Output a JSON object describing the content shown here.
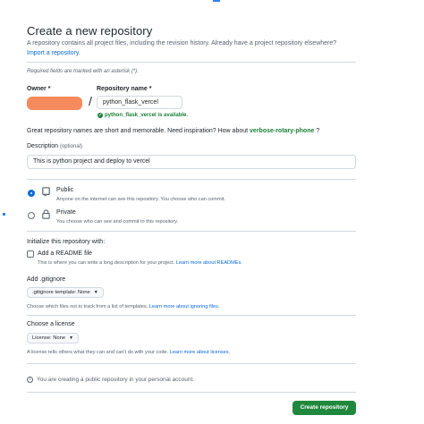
{
  "header": {
    "title": "Create a new repository",
    "subtitle": "A repository contains all project files, including the revision history. Already have a project repository elsewhere?",
    "import_link": "Import a repository."
  },
  "required_note": "Required fields are marked with an asterisk (*).",
  "owner": {
    "label": "Owner *"
  },
  "slash": "/",
  "repo_name": {
    "label": "Repository name *",
    "value": "python_flask_vercel",
    "availability": "python_flask_vercel is available."
  },
  "suggestion": {
    "text": "Great repository names are short and memorable. Need inspiration? How about",
    "name": "verbose-rotary-phone",
    "suffix": "?"
  },
  "description": {
    "label": "Description",
    "optional": "(optional)",
    "value": "This is python project and deploy to vercel"
  },
  "visibility": {
    "public": {
      "label": "Public",
      "desc": "Anyone on the internet can see this repository. You choose who can commit."
    },
    "private": {
      "label": "Private",
      "desc": "You choose who can see and commit to this repository."
    }
  },
  "initialize": {
    "title": "Initialize this repository with:",
    "readme_label": "Add a README file",
    "readme_hint": "This is where you can write a long description for your project.",
    "readme_link": "Learn more about READMEs."
  },
  "gitignore": {
    "title": "Add .gitignore",
    "dropdown": ".gitignore template: None",
    "hint": "Choose which files not to track from a list of templates.",
    "link": "Learn more about ignoring files."
  },
  "license": {
    "title": "Choose a license",
    "dropdown": "License: None",
    "hint": "A license tells others what they can and can't do with your code.",
    "link": "Learn more about licenses."
  },
  "note": "You are creating a public repository in your personal account.",
  "create_button": "Create repository",
  "colors": {
    "accent": "#0969da",
    "primary_button": "#1f883d",
    "success": "#1a7f37",
    "owner_redacted": "#f58a5c"
  }
}
